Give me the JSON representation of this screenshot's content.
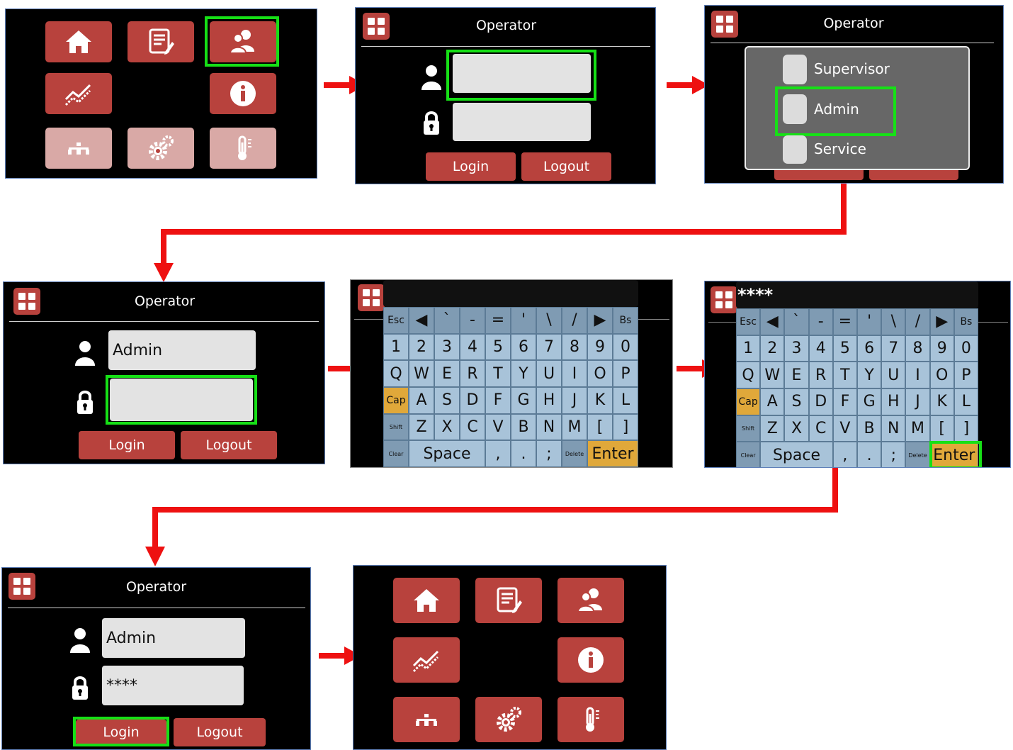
{
  "operator_title": "Operator",
  "username_value": "Admin",
  "password_value": "****",
  "login_label": "Login",
  "logout_label": "Logout",
  "roles": [
    "Supervisor",
    "Admin",
    "Service"
  ],
  "kbd_display": "****",
  "keyboard_rows": [
    [
      "Esc",
      "◀",
      "`",
      "-",
      "=",
      "'",
      "\\",
      "/",
      "▶",
      "Bs"
    ],
    [
      "1",
      "2",
      "3",
      "4",
      "5",
      "6",
      "7",
      "8",
      "9",
      "0"
    ],
    [
      "Q",
      "W",
      "E",
      "R",
      "T",
      "Y",
      "U",
      "I",
      "O",
      "P"
    ],
    [
      "Cap",
      "A",
      "S",
      "D",
      "F",
      "G",
      "H",
      "J",
      "K",
      "L"
    ],
    [
      "Shift",
      "Z",
      "X",
      "C",
      "V",
      "B",
      "N",
      "M",
      "[",
      "]"
    ]
  ],
  "keyboard_bottom": {
    "clear": "Clear",
    "space": "Space",
    "comma": ",",
    "period": ".",
    "semicolon": ";",
    "delete": "Delete",
    "enter": "Enter"
  },
  "icons": [
    "home-icon",
    "document-edit-icon",
    "users-icon",
    "trend-chart-icon",
    "info-icon",
    "network-icon",
    "settings-gears-icon",
    "thermometer-icon"
  ],
  "colors": {
    "accent": "#b8423d",
    "highlight": "#16e016",
    "arrow": "#ee1111",
    "key": "#a8c3d9",
    "enter_key": "#e0a83a"
  }
}
